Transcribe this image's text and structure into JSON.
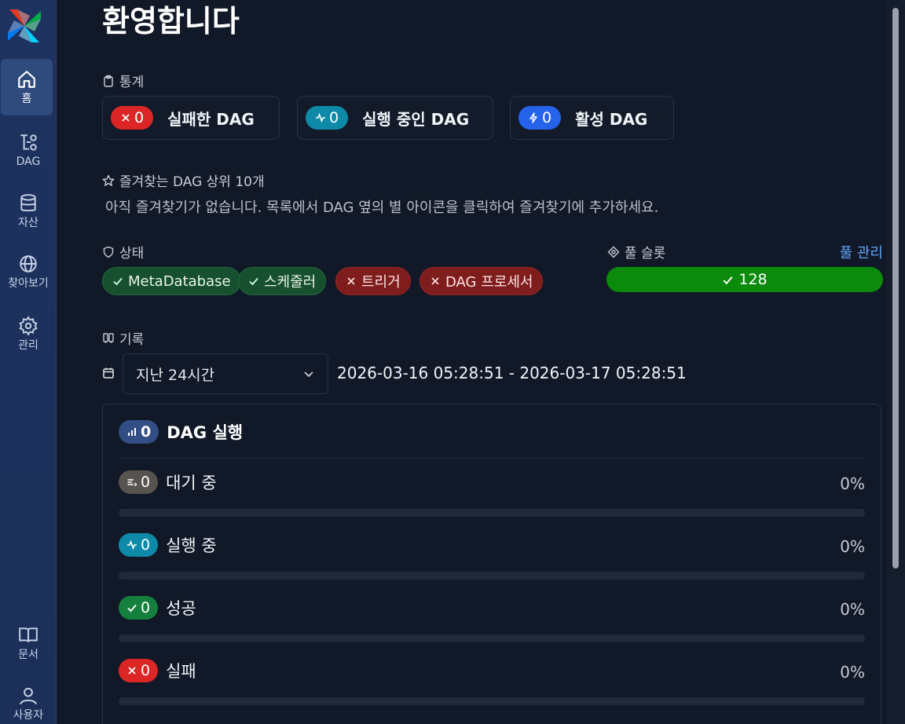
{
  "sidebar": {
    "items": [
      {
        "label": "홈",
        "icon": "home-icon"
      },
      {
        "label": "DAG",
        "icon": "dag-icon"
      },
      {
        "label": "자산",
        "icon": "database-icon"
      },
      {
        "label": "찾아보기",
        "icon": "globe-icon"
      },
      {
        "label": "관리",
        "icon": "gear-icon"
      },
      {
        "label": "문서",
        "icon": "book-icon"
      },
      {
        "label": "사용자",
        "icon": "user-icon"
      }
    ]
  },
  "page": {
    "title": "환영합니다"
  },
  "stats": {
    "heading": "통계",
    "cards": [
      {
        "count": "0",
        "label": "실패한 DAG",
        "color": "#dc2626"
      },
      {
        "count": "0",
        "label": "실행 중인 DAG",
        "color": "#0e8aa8"
      },
      {
        "count": "0",
        "label": "활성 DAG",
        "color": "#2563eb"
      }
    ]
  },
  "favorites": {
    "heading": "즐겨찾는 DAG 상위 10개",
    "empty_text": "아직 즐겨찾기가 없습니다. 목록에서 DAG 옆의 별 아이콘을 클릭하여 즐겨찾기에 추가하세요."
  },
  "health": {
    "heading": "상태",
    "items": [
      {
        "label": "MetaDatabase",
        "ok": true
      },
      {
        "label": "스케줄러",
        "ok": true
      },
      {
        "label": "트리거",
        "ok": false
      },
      {
        "label": "DAG 프로세서",
        "ok": false
      }
    ]
  },
  "pool": {
    "heading": "풀 슬롯",
    "manage_label": "풀 관리",
    "value": "128",
    "color": "#0c8a0c"
  },
  "history": {
    "heading": "기록",
    "range_select": "지난 24시간",
    "range_text": "2026-03-16 05:28:51 - 2026-03-17 05:28:51",
    "dag_runs": {
      "count": "0",
      "label": "DAG 실행"
    },
    "rows": [
      {
        "count": "0",
        "label": "대기 중",
        "pct": "0%",
        "fraction": 0,
        "color": "#57534e"
      },
      {
        "count": "0",
        "label": "실행 중",
        "pct": "0%",
        "fraction": 0,
        "color": "#0e8aa8"
      },
      {
        "count": "0",
        "label": "성공",
        "pct": "0%",
        "fraction": 0,
        "color": "#15803d"
      },
      {
        "count": "0",
        "label": "실패",
        "pct": "0%",
        "fraction": 0,
        "color": "#dc2626"
      }
    ]
  }
}
